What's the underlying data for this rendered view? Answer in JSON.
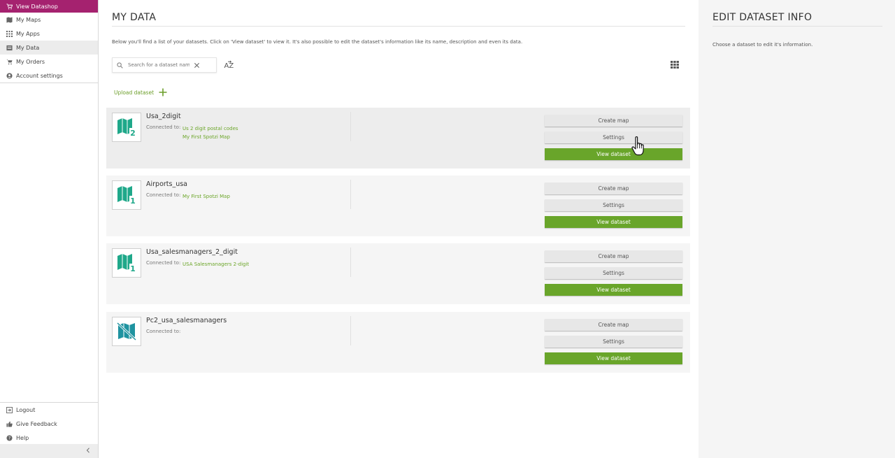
{
  "sidebar": {
    "items": [
      {
        "label": "View Datashop",
        "icon": "cart-icon"
      },
      {
        "label": "My Maps",
        "icon": "map-icon"
      },
      {
        "label": "My Apps",
        "icon": "apps-grid-icon"
      },
      {
        "label": "My Data",
        "icon": "data-icon"
      },
      {
        "label": "My Orders",
        "icon": "cart-icon"
      },
      {
        "label": "Account settings",
        "icon": "account-icon"
      }
    ],
    "bottom_items": [
      {
        "label": "Logout",
        "icon": "logout-icon"
      },
      {
        "label": "Give Feedback",
        "icon": "thumbs-up-icon"
      },
      {
        "label": "Help",
        "icon": "help-icon"
      }
    ],
    "collapse_icon": "chevron-left-icon"
  },
  "main": {
    "title": "MY DATA",
    "intro": "Below you'll find a list of your datasets. Click on 'View dataset' to view it. It's also possible to edit the dataset's information like its name, description and even its data.",
    "search": {
      "placeholder": "Search for a dataset nam",
      "value": ""
    },
    "sort_label": "AZ",
    "upload_label": "Upload dataset",
    "datasets": [
      {
        "name": "Usa_2digit",
        "connected_label": "Connected to:",
        "connections": [
          "Us 2 digit postal codes",
          "My First Spotzi Map"
        ],
        "thumb_icon": "map-2-icon",
        "buttons": {
          "create": "Create map",
          "settings": "Settings",
          "view": "View dataset"
        }
      },
      {
        "name": "Airports_usa",
        "connected_label": "Connected to:",
        "connections": [
          "My First Spotzi Map"
        ],
        "thumb_icon": "map-1-icon",
        "buttons": {
          "create": "Create map",
          "settings": "Settings",
          "view": "View dataset"
        }
      },
      {
        "name": "Usa_salesmanagers_2_digit",
        "connected_label": "Connected to:",
        "connections": [
          "USA Salesmanagers 2-digit"
        ],
        "thumb_icon": "map-1-icon",
        "buttons": {
          "create": "Create map",
          "settings": "Settings",
          "view": "View dataset"
        }
      },
      {
        "name": "Pc2_usa_salesmanagers",
        "connected_label": "Connected to:",
        "connections": [],
        "thumb_icon": "map-disabled-icon",
        "buttons": {
          "create": "Create map",
          "settings": "Settings",
          "view": "View dataset"
        }
      }
    ]
  },
  "right_panel": {
    "title": "EDIT DATASET INFO",
    "text": "Choose a dataset to edit it's information."
  },
  "colors": {
    "brand": "#a5226f",
    "accent_green": "#69a52a",
    "link_green": "#6ca62a",
    "map_icon_teal": "#1fa88a"
  }
}
